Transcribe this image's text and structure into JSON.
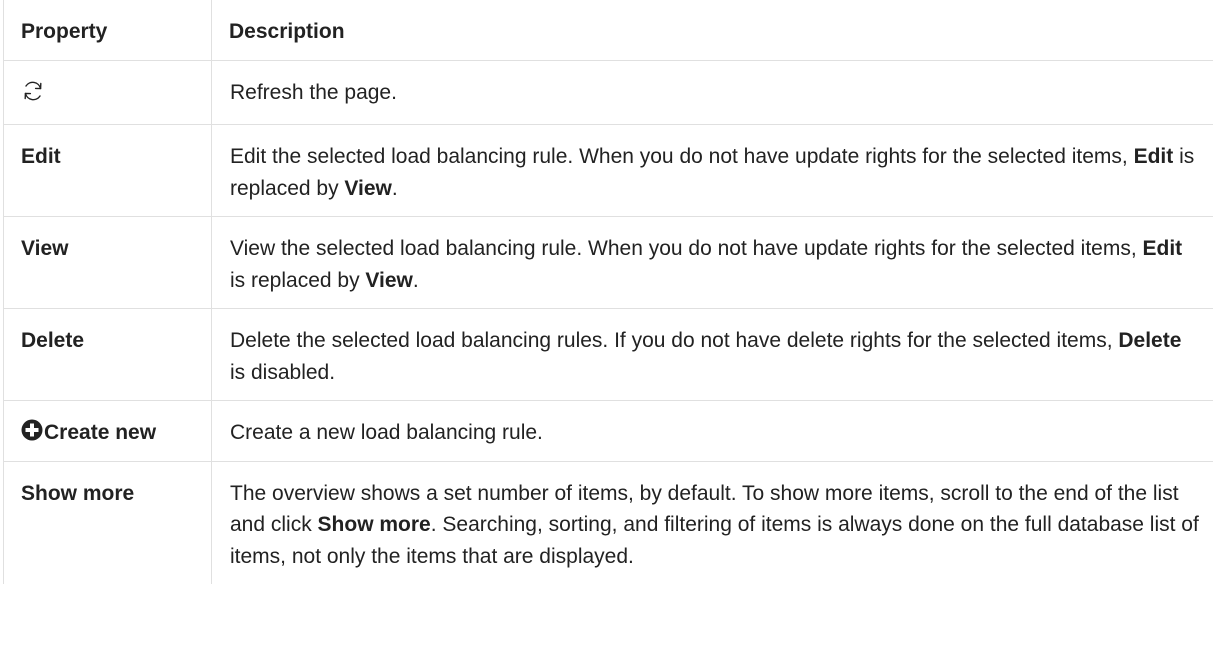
{
  "table": {
    "headers": {
      "property": "Property",
      "description": "Description"
    },
    "rows": [
      {
        "property_icon": "refresh-icon",
        "description": "Refresh the page."
      },
      {
        "property": "Edit",
        "description_parts": [
          "Edit the selected load balancing rule. When you do not have update rights for the selected items, ",
          "Edit",
          " is replaced by ",
          "View",
          "."
        ]
      },
      {
        "property": "View",
        "description_parts": [
          "View the selected load balancing rule. When you do not have update rights for the selected items, ",
          "Edit",
          " is replaced by ",
          "View",
          "."
        ]
      },
      {
        "property": "Delete",
        "description_parts": [
          "Delete the selected load balancing rules. If you do not have delete rights for the selected items, ",
          "Delete",
          " is disabled."
        ]
      },
      {
        "property_icon": "plus-circle-icon",
        "property": "Create new",
        "description": "Create a new load balancing rule."
      },
      {
        "property": "Show more",
        "description_parts": [
          "The overview shows a set number of items, by default. To show more items, scroll to the end of the list and click ",
          "Show more",
          ". Searching, sorting, and filtering of items is always done on the full database list of items, not only the items that are displayed."
        ]
      }
    ]
  }
}
